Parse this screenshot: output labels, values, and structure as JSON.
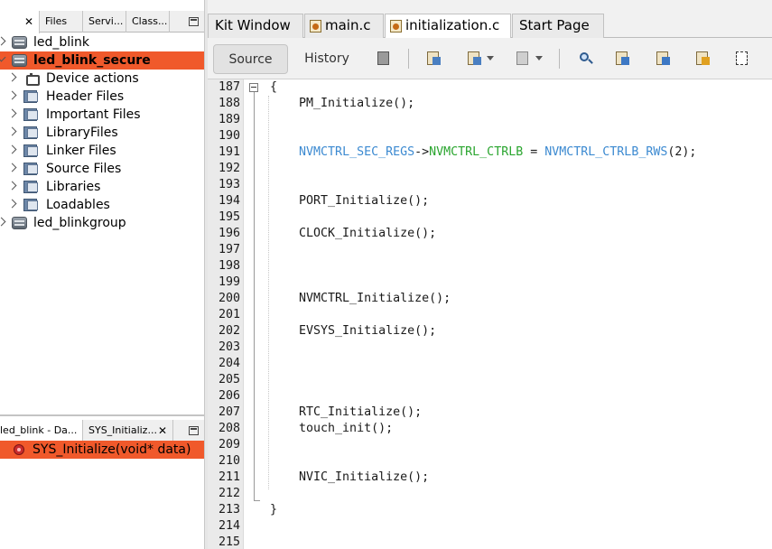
{
  "left_panel": {
    "top_tabs": [
      {
        "label": ""
      },
      {
        "label": "Files"
      },
      {
        "label": "Servi..."
      },
      {
        "label": "Class..."
      }
    ],
    "tree": [
      {
        "label": "led_blink",
        "kind": "project",
        "level": 0,
        "selected": false
      },
      {
        "label": "led_blink_secure",
        "kind": "project",
        "level": 0,
        "selected": true
      },
      {
        "label": "Device actions",
        "kind": "actions",
        "level": 1,
        "selected": false
      },
      {
        "label": "Header Files",
        "kind": "folder",
        "level": 1,
        "selected": false
      },
      {
        "label": "Important Files",
        "kind": "folder",
        "level": 1,
        "selected": false
      },
      {
        "label": "LibraryFiles",
        "kind": "folder",
        "level": 1,
        "selected": false
      },
      {
        "label": "Linker Files",
        "kind": "folder",
        "level": 1,
        "selected": false
      },
      {
        "label": "Source Files",
        "kind": "folder",
        "level": 1,
        "selected": false
      },
      {
        "label": "Libraries",
        "kind": "folder",
        "level": 1,
        "selected": false
      },
      {
        "label": "Loadables",
        "kind": "folder",
        "level": 1,
        "selected": false
      },
      {
        "label": "led_blinkgroup",
        "kind": "project",
        "level": 0,
        "selected": false
      }
    ],
    "bottom_tabs": [
      {
        "label": "led_blink - Da..."
      },
      {
        "label": "SYS_Initializ..."
      }
    ],
    "navigator_item": "SYS_Initialize(void* data)"
  },
  "editor": {
    "tabs": [
      {
        "label": "Kit Window",
        "icon": "none"
      },
      {
        "label": "main.c",
        "icon": "c-file-icon"
      },
      {
        "label": "initialization.c",
        "icon": "c-file-icon",
        "active": true
      },
      {
        "label": "Start Page",
        "icon": "none"
      }
    ],
    "toolbar": {
      "source_label": "Source",
      "history_label": "History"
    },
    "lines": [
      {
        "n": "187",
        "code": "{"
      },
      {
        "n": "188",
        "code": "    PM_Initialize();"
      },
      {
        "n": "189",
        "code": ""
      },
      {
        "n": "190",
        "code": ""
      },
      {
        "n": "191",
        "code": "    NVMCTRL_SEC_REGS->NVMCTRL_CTRLB = NVMCTRL_CTRLB_RWS(2);"
      },
      {
        "n": "192",
        "code": ""
      },
      {
        "n": "193",
        "code": ""
      },
      {
        "n": "194",
        "code": "    PORT_Initialize();"
      },
      {
        "n": "195",
        "code": ""
      },
      {
        "n": "196",
        "code": "    CLOCK_Initialize();"
      },
      {
        "n": "197",
        "code": ""
      },
      {
        "n": "198",
        "code": ""
      },
      {
        "n": "199",
        "code": ""
      },
      {
        "n": "200",
        "code": "    NVMCTRL_Initialize();"
      },
      {
        "n": "201",
        "code": ""
      },
      {
        "n": "202",
        "code": "    EVSYS_Initialize();"
      },
      {
        "n": "203",
        "code": ""
      },
      {
        "n": "204",
        "code": ""
      },
      {
        "n": "205",
        "code": ""
      },
      {
        "n": "206",
        "code": ""
      },
      {
        "n": "207",
        "code": "    RTC_Initialize();"
      },
      {
        "n": "208",
        "code": "    touch_init();"
      },
      {
        "n": "209",
        "code": ""
      },
      {
        "n": "210",
        "code": ""
      },
      {
        "n": "211",
        "code": "    NVIC_Initialize();"
      },
      {
        "n": "212",
        "code": ""
      },
      {
        "n": "213",
        "code": "}"
      },
      {
        "n": "214",
        "code": ""
      },
      {
        "n": "215",
        "code": ""
      }
    ],
    "syntax": {
      "line_191": {
        "p1": "NVMCTRL_SEC_REGS",
        "p2": "->",
        "p3": "NVMCTRL_CTRLB",
        "p4": " = ",
        "p5": "NVMCTRL_CTRLB_RWS",
        "p6": "(2);"
      }
    }
  },
  "colors": {
    "selection": "#f0592b",
    "identifier": "#3c8ad1",
    "member": "#2aa52f"
  }
}
